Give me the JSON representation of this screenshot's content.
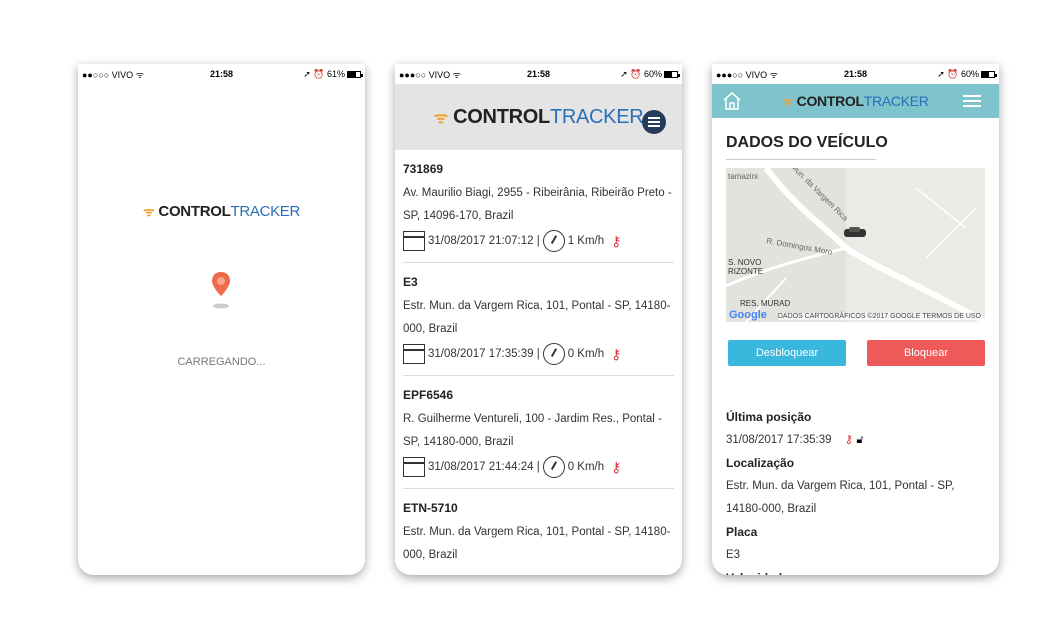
{
  "status": {
    "screen1": {
      "carrier": "●●○○○ VIVO ᯤ",
      "time": "21:58",
      "battery": "➚ ⏰ 61%"
    },
    "screen2": {
      "carrier": "●●●○○ VIVO ᯤ",
      "time": "21:58",
      "battery": "➚ ⏰ 60%"
    },
    "screen3": {
      "carrier": "●●●○○ VIVO ᯤ",
      "time": "21:58",
      "battery": "➚ ⏰ 60%"
    }
  },
  "brand": {
    "part1": "CONTROL",
    "part2": "TRACKER"
  },
  "loading": {
    "text": "CARREGANDO..."
  },
  "vehicles": [
    {
      "plate": "731869",
      "address": "Av. Maurilio Biagi, 2955 - Ribeirânia, Ribeirão Preto - SP, 14096-170, Brazil",
      "datetime": "31/08/2017 21:07:12 |",
      "speed": "1 Km/h"
    },
    {
      "plate": "E3",
      "address": "Estr. Mun. da Vargem Rica, 101, Pontal - SP, 14180-000, Brazil",
      "datetime": "31/08/2017 17:35:39 |",
      "speed": "0 Km/h"
    },
    {
      "plate": "EPF6546",
      "address": "R. Guilherme Ventureli, 100 - Jardim Res., Pontal - SP, 14180-000, Brazil",
      "datetime": "31/08/2017 21:44:24 |",
      "speed": "0 Km/h"
    },
    {
      "plate": "ETN-5710",
      "address": "Estr. Mun. da Vargem Rica, 101, Pontal - SP, 14180-000, Brazil",
      "datetime": "",
      "speed": ""
    }
  ],
  "detail": {
    "title": "DADOS DO VEÍCULO",
    "map": {
      "street1": "Mun. da Vargem Rica",
      "street2": "R. Domingos Moro",
      "area": "S. NOVO\nRIZONTE",
      "area2": "RES. MURAD",
      "corner": "tamazini",
      "credit": "DADOS CARTOGRÁFICOS ©2017 GOOGLE   TERMOS DE USO",
      "google": "Google"
    },
    "buttons": {
      "unlock": "Desbloquear",
      "lock": "Bloquear"
    },
    "last_position_label": "Última posição",
    "last_position_value": "31/08/2017 17:35:39",
    "location_label": "Localização",
    "location_value": "Estr. Mun. da Vargem Rica, 101, Pontal - SP, 14180-000, Brazil",
    "plate_label": "Placa",
    "plate_value": "E3",
    "speed_label": "Velocidade"
  },
  "colors": {
    "brand_blue": "#2a6fb8",
    "header3": "#7fc4cc",
    "unlock": "#3ab7dc",
    "lock": "#ee5a5a"
  }
}
